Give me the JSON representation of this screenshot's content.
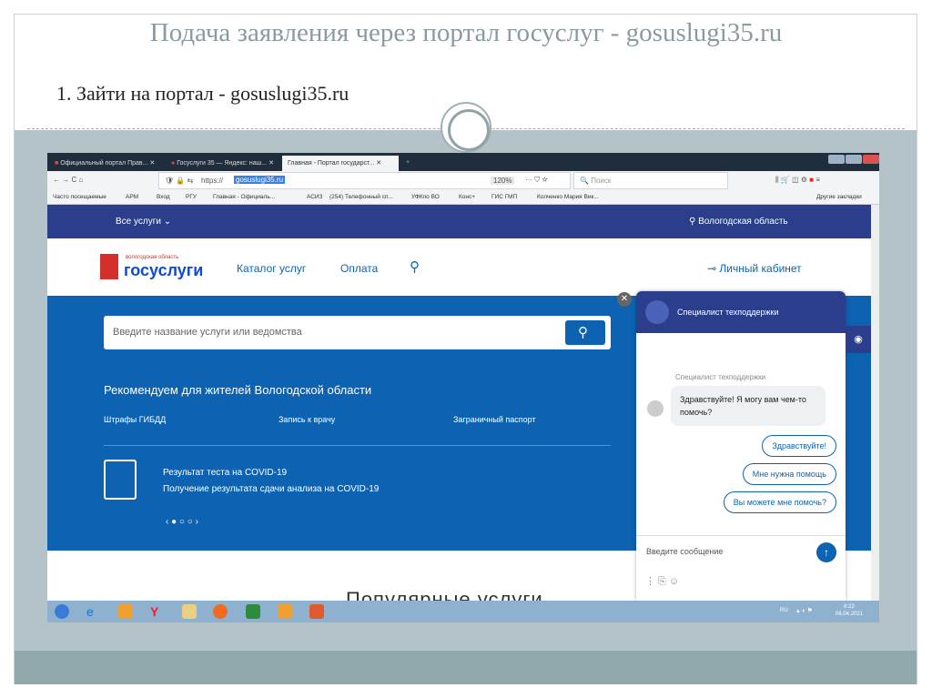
{
  "slide": {
    "title": "Подача заявления через портал госуслуг - gosuslugi35.ru",
    "step": "1. Зайти на портал - gosuslugi35.ru"
  },
  "browser": {
    "tabs": [
      "Официальный портал Прав...",
      "Госуслуги 35 — Яндекс: наш...",
      "Главная - Портал государст..."
    ],
    "url_prefix": "https://",
    "url_selected": "gosuslugi35.ru",
    "zoom": "120%",
    "search_placeholder": "Поиск",
    "bookmarks": [
      "Часто посещаемые",
      "АРМ",
      "Вход",
      "РГУ",
      "Главная - Официаль...",
      "АСИЗ",
      "(254) Телефонный сп...",
      "УФКпо ВО",
      "Конс+",
      "ГИС ГМП",
      "Колченко Мария Вик..."
    ],
    "other_bookmarks": "Другие закладки"
  },
  "site": {
    "all_services": "Все услуги ⌄",
    "region": "Вологодская область",
    "logo_top": "вологодская область",
    "logo": "госуслуги",
    "nav": [
      "Каталог услуг",
      "Оплата"
    ],
    "cabinet": "Личный кабинет",
    "search_placeholder": "Введите название услуги или ведомства",
    "recommend_title": "Рекомендуем для жителей Вологодской области",
    "recommend": [
      "Штрафы ГИБДД",
      "Запись к врачу",
      "Заграничный паспорт"
    ],
    "covid_title": "Результат теста на COVID-19",
    "covid_sub": "Получение результата сдачи анализа на COVID-19",
    "popular": "Популярные услуги"
  },
  "chat": {
    "header": "Специалист техподдержки",
    "sender": "Специалист техподдержки",
    "message": "Здравствуйте! Я могу вам чем-то помочь?",
    "quick": [
      "Здравствуйте!",
      "Мне нужна помощь",
      "Вы можете мне помочь?"
    ],
    "input_placeholder": "Введите сообщение"
  },
  "taskbar": {
    "lang": "RU",
    "time": "8:22",
    "date": "06.04.2021"
  }
}
